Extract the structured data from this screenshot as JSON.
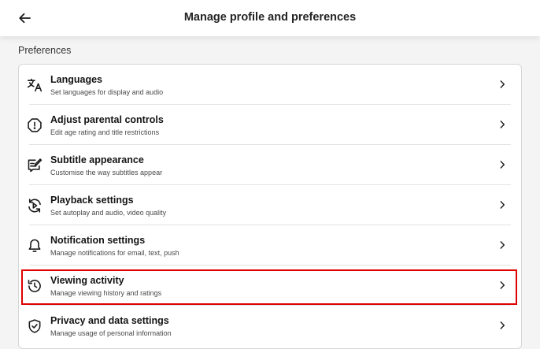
{
  "header": {
    "title": "Manage profile and preferences",
    "back_icon": "arrow-left-icon"
  },
  "section": {
    "title": "Preferences"
  },
  "items": [
    {
      "label": "Languages",
      "description": "Set languages for display and audio",
      "icon": "translate-icon"
    },
    {
      "label": "Adjust parental controls",
      "description": "Edit age rating and title restrictions",
      "icon": "alert-octagon-icon"
    },
    {
      "label": "Subtitle appearance",
      "description": "Customise the way subtitles appear",
      "icon": "subtitle-edit-icon"
    },
    {
      "label": "Playback settings",
      "description": "Set autoplay and audio, video quality",
      "icon": "playback-refresh-icon"
    },
    {
      "label": "Notification settings",
      "description": "Manage notifications for email, text, push",
      "icon": "bell-icon"
    },
    {
      "label": "Viewing activity",
      "description": "Manage viewing history and ratings",
      "icon": "history-icon"
    },
    {
      "label": "Privacy and data settings",
      "description": "Manage usage of personal information",
      "icon": "shield-check-icon"
    }
  ],
  "highlight": {
    "item": "Viewing activity",
    "color": "#e00000"
  }
}
